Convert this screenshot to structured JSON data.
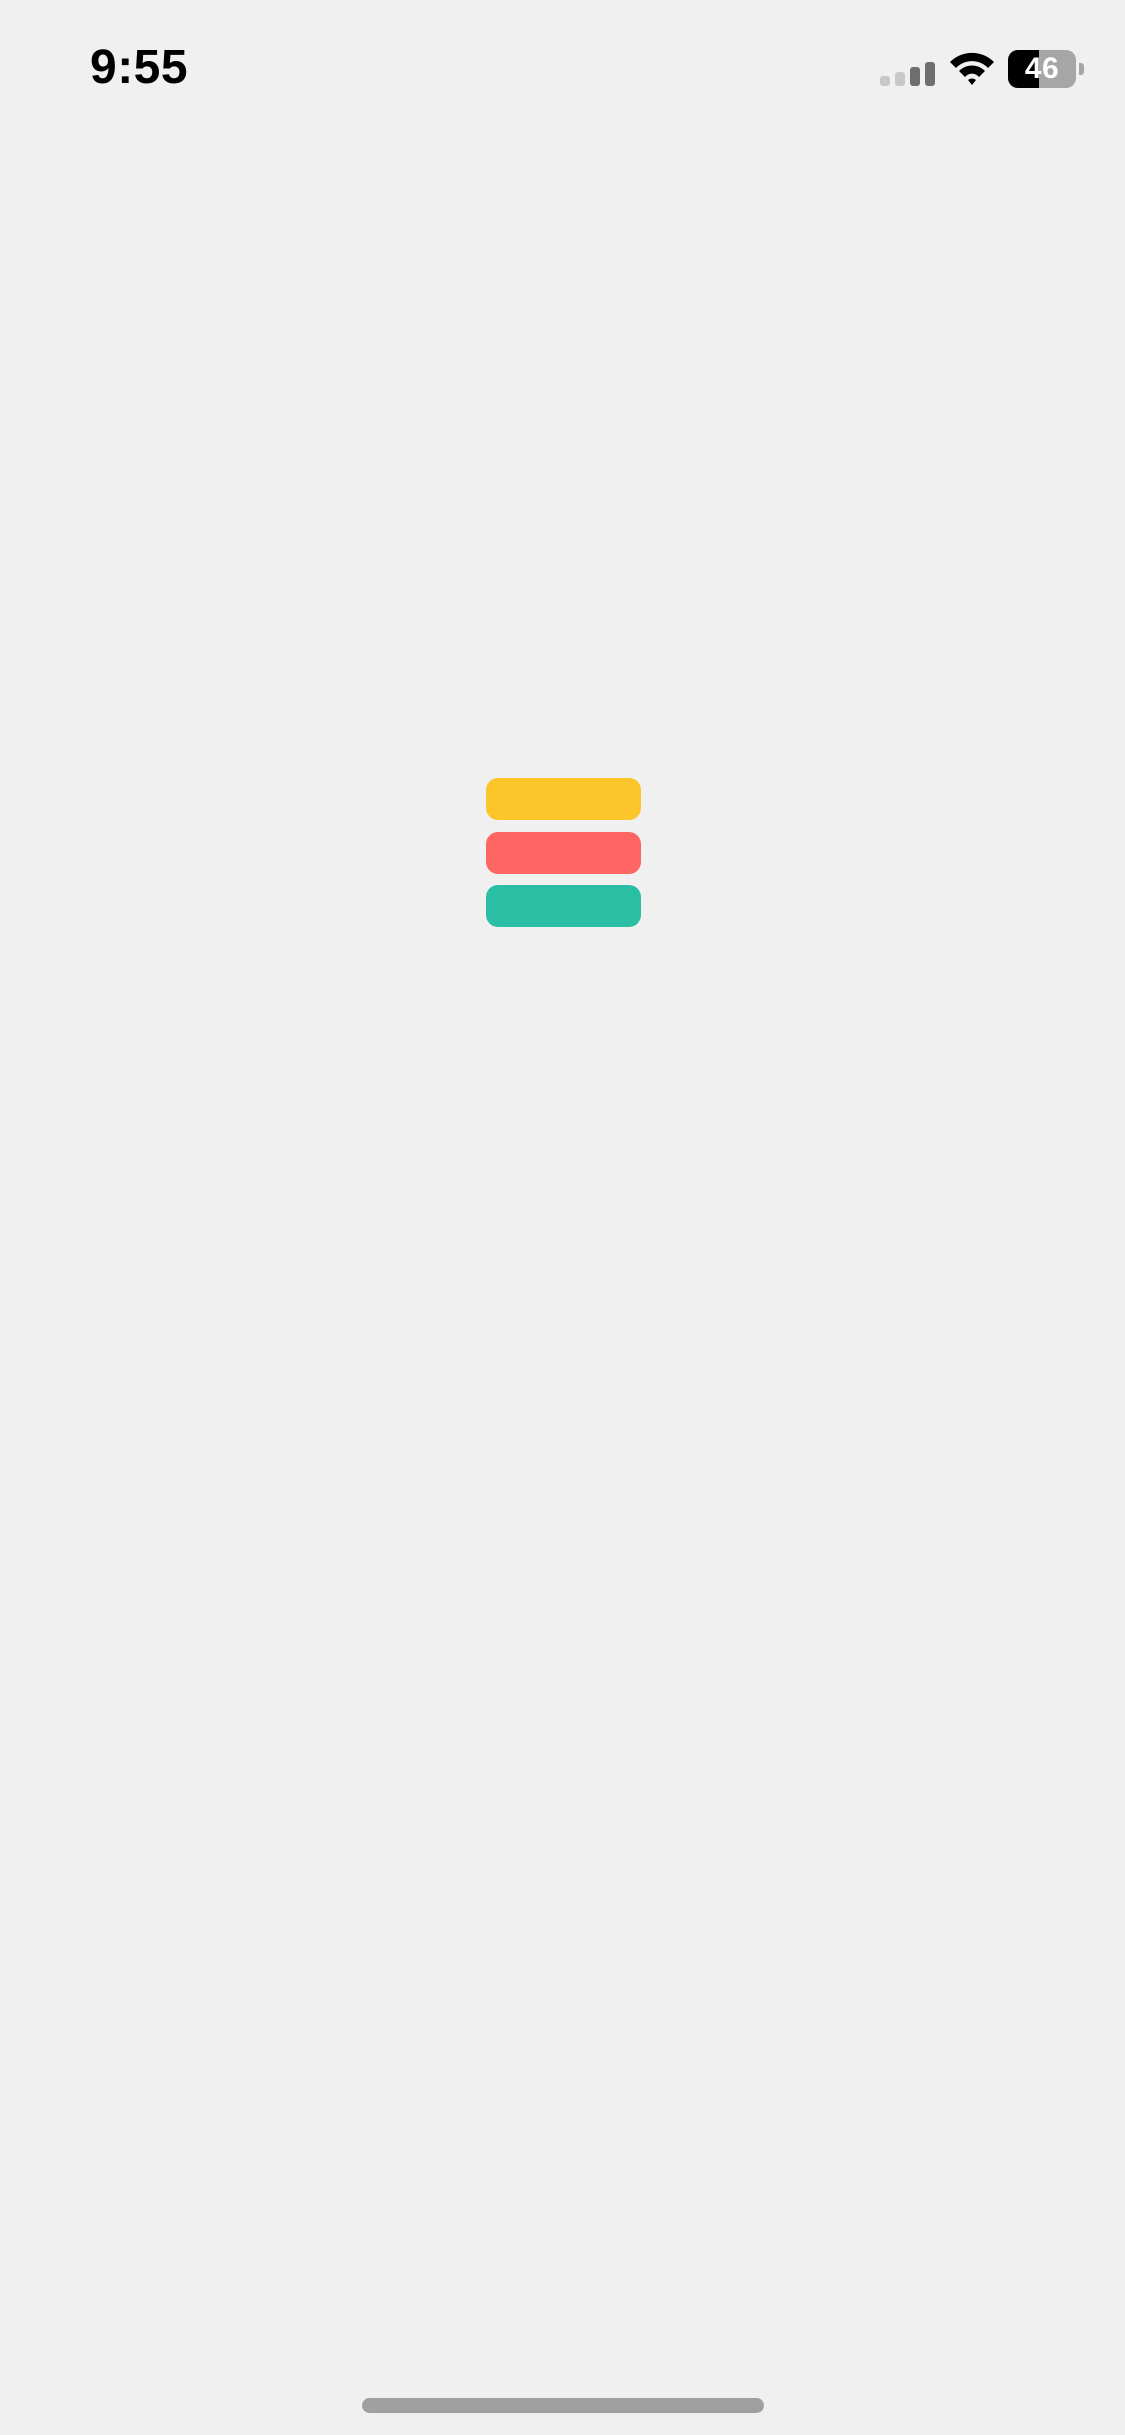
{
  "status_bar": {
    "time": "9:55",
    "battery_percent": 46,
    "battery_label": "46",
    "signal_icon": "cellular-signal-icon",
    "wifi_icon": "wifi-icon"
  },
  "logo": {
    "icon": "app-logo-icon",
    "bar_colors": [
      "#fcc62a",
      "#fd6663",
      "#2abfa4"
    ]
  },
  "colors": {
    "background": "#f0f0f0",
    "home_indicator": "#a0a0a0"
  }
}
